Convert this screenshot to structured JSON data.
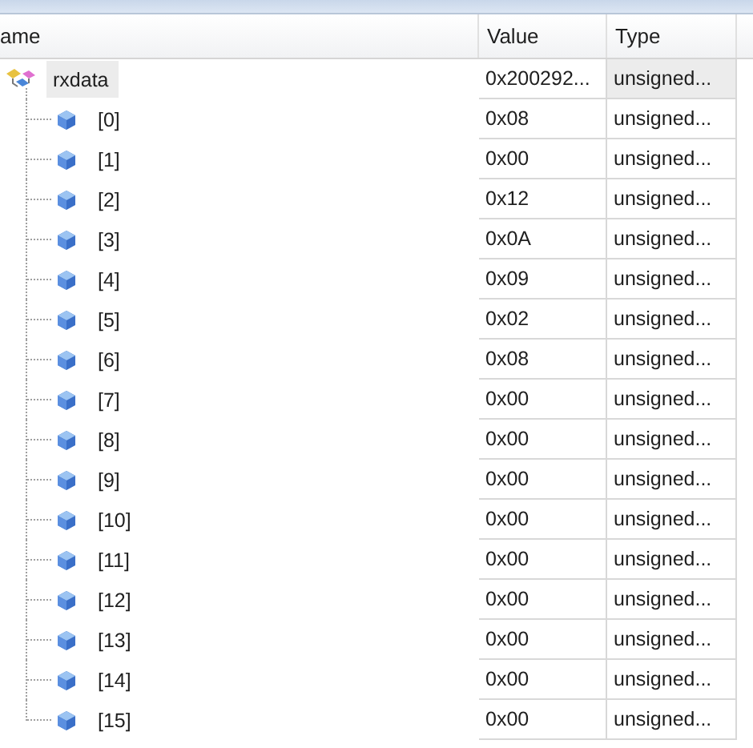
{
  "columns": [
    "ame",
    "Value",
    "Type"
  ],
  "root": {
    "name": "rxdata",
    "value": "0x200292...",
    "type": "unsigned...",
    "selected": true,
    "children": [
      {
        "name": "[0]",
        "value": "0x08",
        "type": "unsigned...",
        "selected": false
      },
      {
        "name": "[1]",
        "value": "0x00",
        "type": "unsigned...",
        "selected": false
      },
      {
        "name": "[2]",
        "value": "0x12",
        "type": "unsigned...",
        "selected": false
      },
      {
        "name": "[3]",
        "value": "0x0A",
        "type": "unsigned...",
        "selected": false
      },
      {
        "name": "[4]",
        "value": "0x09",
        "type": "unsigned...",
        "selected": false
      },
      {
        "name": "[5]",
        "value": "0x02",
        "type": "unsigned...",
        "selected": false
      },
      {
        "name": "[6]",
        "value": "0x08",
        "type": "unsigned...",
        "selected": false
      },
      {
        "name": "[7]",
        "value": "0x00",
        "type": "unsigned...",
        "selected": false
      },
      {
        "name": "[8]",
        "value": "0x00",
        "type": "unsigned...",
        "selected": false
      },
      {
        "name": "[9]",
        "value": "0x00",
        "type": "unsigned...",
        "selected": false
      },
      {
        "name": "[10]",
        "value": "0x00",
        "type": "unsigned...",
        "selected": false
      },
      {
        "name": "[11]",
        "value": "0x00",
        "type": "unsigned...",
        "selected": false
      },
      {
        "name": "[12]",
        "value": "0x00",
        "type": "unsigned...",
        "selected": false
      },
      {
        "name": "[13]",
        "value": "0x00",
        "type": "unsigned...",
        "selected": false
      },
      {
        "name": "[14]",
        "value": "0x00",
        "type": "unsigned...",
        "selected": false
      },
      {
        "name": "[15]",
        "value": "0x00",
        "type": "unsigned...",
        "selected": false
      }
    ]
  }
}
